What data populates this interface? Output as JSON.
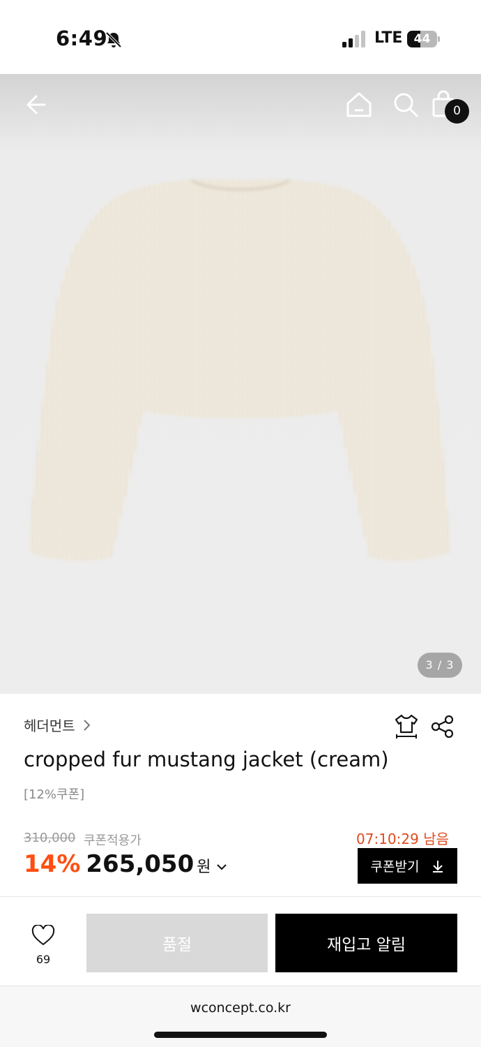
{
  "status_bar": {
    "time": "6:49",
    "network": "LTE",
    "battery_level": "44",
    "battery_fraction": 0.44,
    "icons": [
      "bell-slash-icon",
      "signal-icon",
      "battery-icon"
    ]
  },
  "header": {
    "icons": [
      "back-arrow-icon",
      "home-icon",
      "search-icon",
      "cart-icon"
    ],
    "cart_count": "0"
  },
  "gallery": {
    "counter": "3 / 3",
    "image": "cream fur cropped jacket"
  },
  "product": {
    "brand": "헤더먼트",
    "title": "cropped fur mustang jacket (cream)",
    "coupon_tag": "[12%쿠폰]",
    "original_price": "310,000",
    "coupon_applied_label": "쿠폰적용가",
    "timer": "07:10:29 남음",
    "discount": "14%",
    "price": "265,050",
    "currency": "원",
    "coupon_button": "쿠폰받기"
  },
  "actions": {
    "wish_count": "69",
    "soldout_label": "품절",
    "restock_label": "재입고 알림"
  },
  "browser": {
    "url": "wconcept.co.kr"
  },
  "colors": {
    "accent_orange": "#ff4e12",
    "timer_red": "#e04a1f",
    "primary_black": "#000000",
    "disabled_gray": "#d9d9d9"
  }
}
